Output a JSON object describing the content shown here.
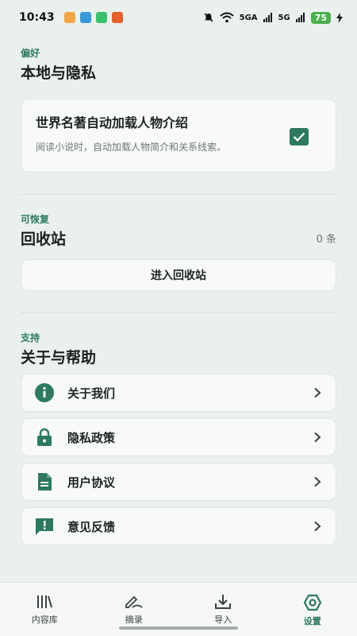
{
  "status_bar": {
    "time": "10:43",
    "network_1": "5GA",
    "network_2": "5G",
    "battery": "75"
  },
  "preferences": {
    "section_label": "偏好",
    "section_title": "本地与隐私",
    "toggle_title": "世界名著自动加载人物介绍",
    "toggle_desc": "阅读小说时，自动加载人物简介和关系线索。",
    "checked": true
  },
  "recycle": {
    "section_label": "可恢复",
    "section_title": "回收站",
    "count": "0 条",
    "button_label": "进入回收站"
  },
  "help": {
    "section_label": "支持",
    "section_title": "关于与帮助",
    "items": [
      {
        "label": "关于我们",
        "icon": "info-icon"
      },
      {
        "label": "隐私政策",
        "icon": "lock-icon"
      },
      {
        "label": "用户协议",
        "icon": "document-icon"
      },
      {
        "label": "意见反馈",
        "icon": "feedback-icon"
      }
    ]
  },
  "nav": {
    "items": [
      {
        "label": "内容库",
        "icon": "library-icon",
        "active": false
      },
      {
        "label": "摘录",
        "icon": "excerpt-icon",
        "active": false
      },
      {
        "label": "导入",
        "icon": "import-icon",
        "active": false
      },
      {
        "label": "设置",
        "icon": "settings-icon",
        "active": true
      }
    ]
  },
  "colors": {
    "accent": "#2d7a5e",
    "background": "#eaf1ed"
  }
}
